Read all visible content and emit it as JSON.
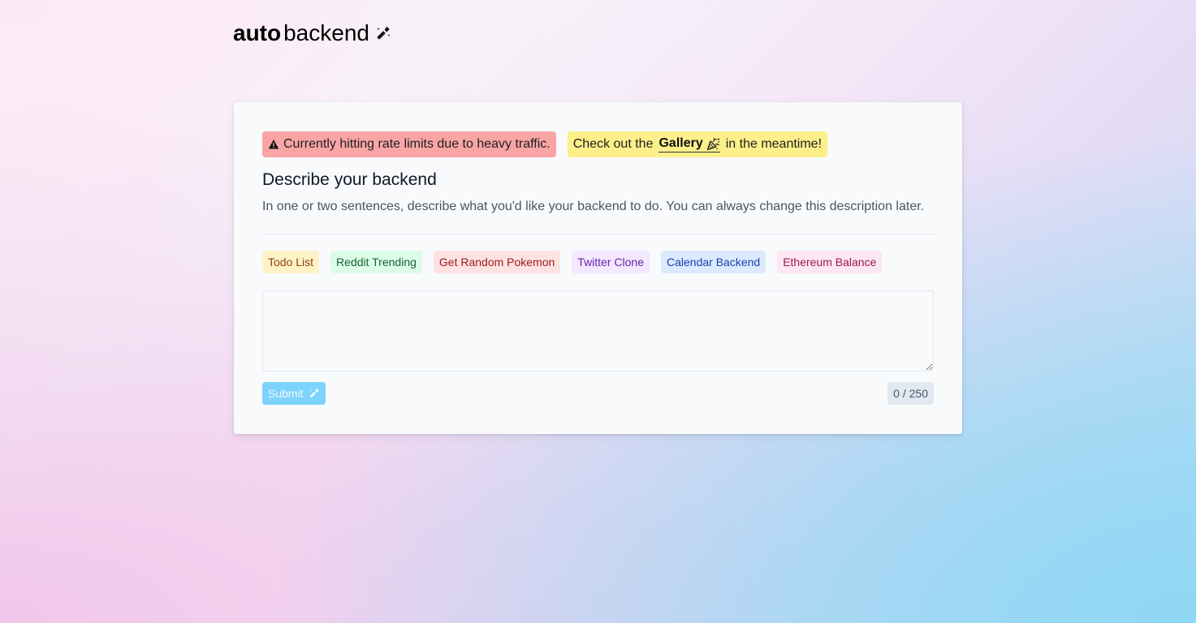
{
  "logo": {
    "bold": "auto",
    "regular": "backend",
    "icon": "magic-wand-icon"
  },
  "alerts": {
    "rate_limit": {
      "icon": "warning-icon",
      "text": "Currently hitting rate limits due to heavy traffic.",
      "color": "#f9a5a5"
    },
    "gallery": {
      "prefix": "Check out the",
      "link_label": "Gallery",
      "link_icon": "party-popper-icon",
      "suffix": "in the meantime!",
      "color": "#fdf08a"
    }
  },
  "form": {
    "heading": "Describe your backend",
    "description": "In one or two sentences, describe what you'd like your backend to do. You can always change this description later.",
    "examples": [
      {
        "label": "Todo List",
        "bg": "#fef3c7",
        "fg": "#92400e"
      },
      {
        "label": "Reddit Trending",
        "bg": "#dcfce7",
        "fg": "#166534"
      },
      {
        "label": "Get Random Pokemon",
        "bg": "#fee2e2",
        "fg": "#991b1b"
      },
      {
        "label": "Twitter Clone",
        "bg": "#f3e8ff",
        "fg": "#6b21a8"
      },
      {
        "label": "Calendar Backend",
        "bg": "#dbeafe",
        "fg": "#1e40af"
      },
      {
        "label": "Ethereum Balance",
        "bg": "#fce7f3",
        "fg": "#9d174d"
      }
    ],
    "textarea_value": "",
    "submit_label": "Submit",
    "submit_icon": "magic-wand-icon",
    "counter": "0 / 250"
  }
}
